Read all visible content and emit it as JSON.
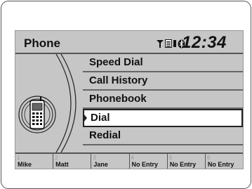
{
  "header": {
    "title": "Phone",
    "clock": "12:34",
    "status_icons": [
      "signal-icon",
      "hfl-icon",
      "bluetooth-icon"
    ],
    "hfl_text": "HFL"
  },
  "menu": {
    "items": [
      {
        "label": "Speed Dial"
      },
      {
        "label": "Call History"
      },
      {
        "label": "Phonebook"
      },
      {
        "label": "Dial",
        "selected": true
      },
      {
        "label": "Redial"
      }
    ]
  },
  "speed_dial": {
    "entries": [
      {
        "slot": "1",
        "name": "Mike"
      },
      {
        "slot": "2",
        "name": "Matt"
      },
      {
        "slot": "3",
        "name": "Jane"
      },
      {
        "slot": "4",
        "name": "No Entry"
      },
      {
        "slot": "5",
        "name": "No Entry"
      },
      {
        "slot": "6",
        "name": "No Entry"
      }
    ]
  },
  "colors": {
    "screen_bg": "#c6c6c6",
    "selected_bg": "#ffffff",
    "text": "#111111"
  }
}
